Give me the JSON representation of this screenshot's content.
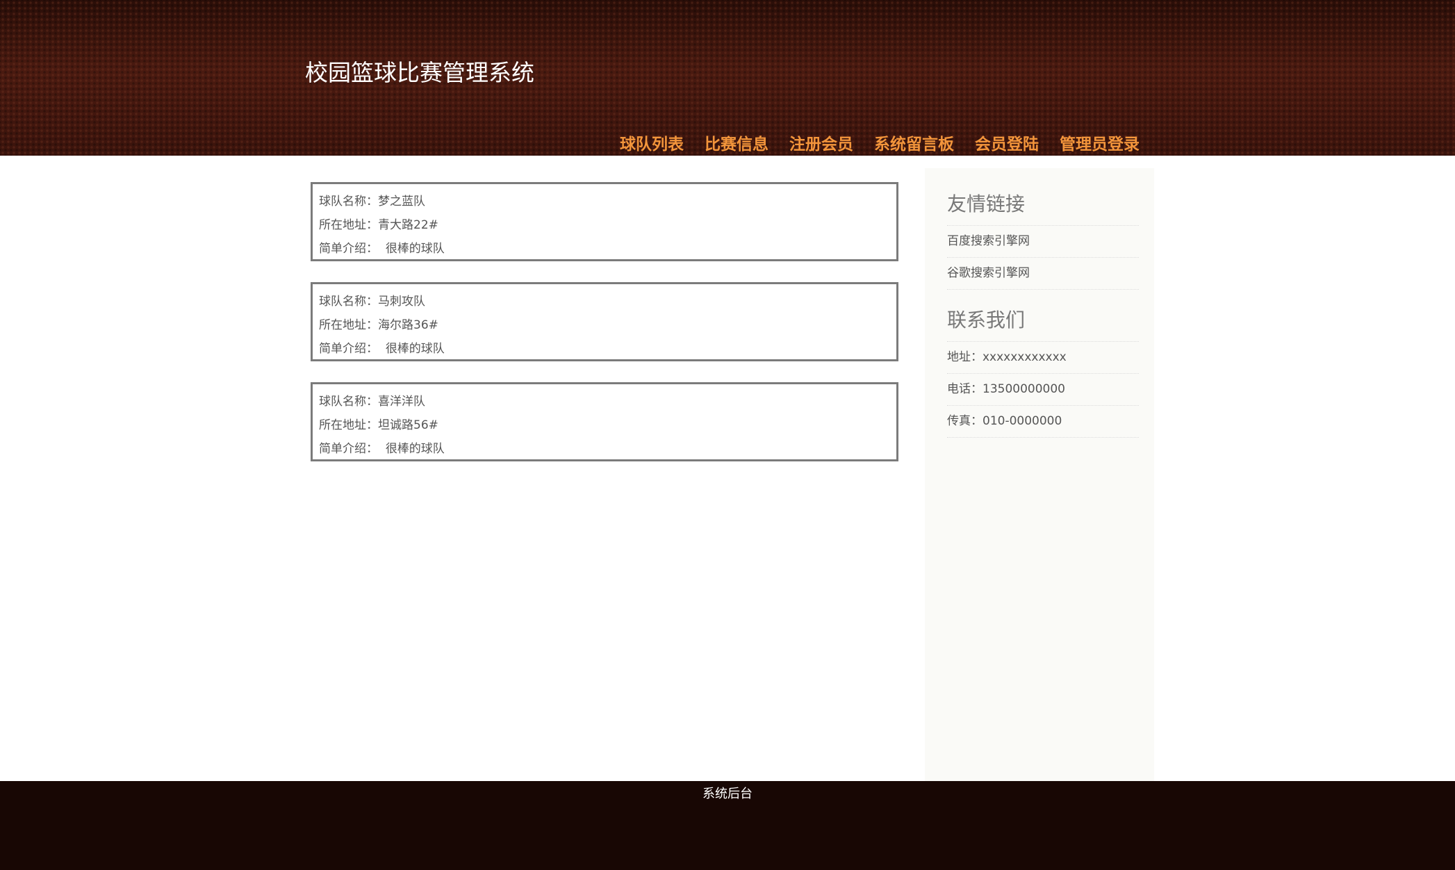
{
  "header": {
    "title": "校园篮球比赛管理系统",
    "nav": [
      "球队列表",
      "比赛信息",
      "注册会员",
      "系统留言板",
      "会员登陆",
      "管理员登录"
    ]
  },
  "teams": [
    {
      "name_label": "球队名称：",
      "name": "梦之蓝队",
      "address_label": "所在地址：",
      "address": "青大路22#",
      "intro_label": "简单介绍：",
      "intro": "很棒的球队"
    },
    {
      "name_label": "球队名称：",
      "name": "马刺攻队",
      "address_label": "所在地址：",
      "address": "海尔路36#",
      "intro_label": "简单介绍：",
      "intro": "很棒的球队"
    },
    {
      "name_label": "球队名称：",
      "name": "喜洋洋队",
      "address_label": "所在地址：",
      "address": "坦诚路56#",
      "intro_label": "简单介绍：",
      "intro": "很棒的球队"
    }
  ],
  "sidebar": {
    "links_heading": "友情链接",
    "links": [
      "百度搜索引擎网",
      "谷歌搜索引擎网"
    ],
    "contact_heading": "联系我们",
    "contact": [
      "地址：xxxxxxxxxxxx",
      "电话：13500000000",
      "传真：010-0000000"
    ]
  },
  "footer": {
    "link": "系统后台"
  },
  "colors": {
    "header_bg": "#3a140d",
    "nav_accent": "#f3953b",
    "footer_bg": "#180704",
    "sidebar_bg": "#fafaf7"
  }
}
